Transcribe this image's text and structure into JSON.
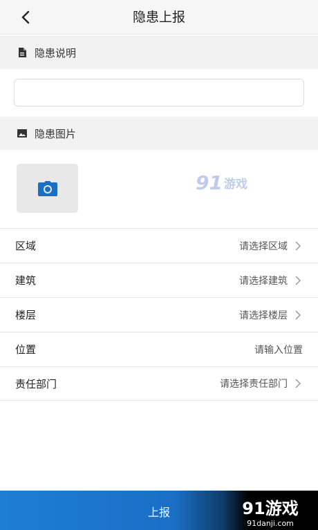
{
  "header": {
    "title": "隐患上报",
    "back_icon": "chevron-left-icon"
  },
  "description_section": {
    "label": "隐患说明",
    "icon": "document-icon",
    "input_value": "",
    "input_placeholder": ""
  },
  "image_section": {
    "label": "隐患图片",
    "icon": "image-icon",
    "camera_icon": "camera-icon"
  },
  "watermark": {
    "big": "91",
    "text": "游戏",
    "sub": "91danji.com"
  },
  "form_rows": [
    {
      "label": "区域",
      "value": "请选择区域",
      "has_chevron": true
    },
    {
      "label": "建筑",
      "value": "请选择建筑",
      "has_chevron": true
    },
    {
      "label": "楼层",
      "value": "请选择楼层",
      "has_chevron": true
    },
    {
      "label": "位置",
      "value": "请输入位置",
      "has_chevron": false
    },
    {
      "label": "责任部门",
      "value": "请选择责任部门",
      "has_chevron": true
    }
  ],
  "submit": {
    "label": "上报"
  },
  "colors": {
    "accent": "#1e7ed4",
    "camera": "#1a6fc4"
  }
}
